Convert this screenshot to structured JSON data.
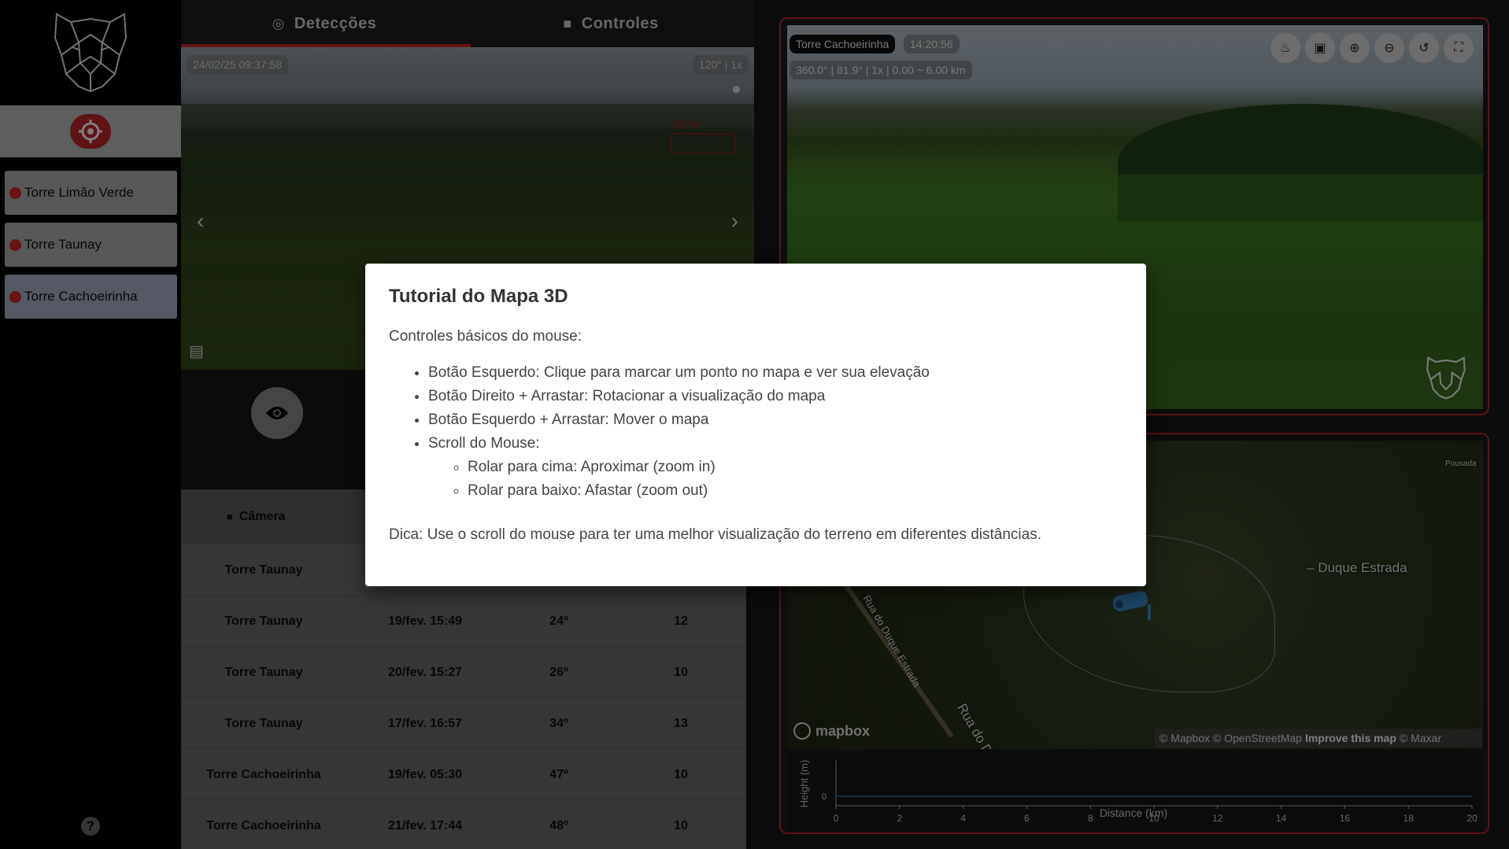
{
  "sidebar": {
    "towers": [
      {
        "label": "Torre Limão Verde"
      },
      {
        "label": "Torre Taunay"
      },
      {
        "label": "Torre Cachoeirinha"
      }
    ],
    "help": "?"
  },
  "tabs": {
    "detections": "Detecções",
    "controls": "Controles"
  },
  "camera": {
    "timestamp": "24/02/25 09:37:58",
    "fov_zoom": "120° | 1x",
    "detection_label": "82 %"
  },
  "table": {
    "headers": [
      "Câmera",
      "",
      "",
      ""
    ],
    "rows": [
      {
        "camera": "Torre Taunay",
        "date": "",
        "angle": "",
        "count": ""
      },
      {
        "camera": "Torre Taunay",
        "date": "19/fev. 15:49",
        "angle": "24º",
        "count": "12"
      },
      {
        "camera": "Torre Taunay",
        "date": "20/fev. 15:27",
        "angle": "26º",
        "count": "10"
      },
      {
        "camera": "Torre Taunay",
        "date": "17/fev. 16:57",
        "angle": "34º",
        "count": "13"
      },
      {
        "camera": "Torre Cachoeirinha",
        "date": "19/fev. 05:30",
        "angle": "47º",
        "count": "10"
      },
      {
        "camera": "Torre Cachoeirinha",
        "date": "21/fev. 17:44",
        "angle": "48º",
        "count": "10"
      }
    ]
  },
  "live": {
    "tower_name": "Torre Cachoeirinha",
    "time": "14:20:56",
    "info": "360.0° | 81.9° | 1x | 0.00 ~ 6.00 km"
  },
  "map": {
    "place_label": "Duque Estrada",
    "road_label_1": "Rua do Duque Estrada",
    "road_label_2": "Rua do D",
    "poi": "Pousada",
    "brand": "mapbox",
    "attribution_1": "© Mapbox © OpenStreetMap",
    "attribution_link": "Improve this map",
    "attribution_2": "© Maxar"
  },
  "profile_chart": {
    "ylabel": "Height (m)",
    "xlabel": "Distance (km)",
    "y_tick": "0",
    "x_ticks": [
      "0",
      "2",
      "4",
      "6",
      "8",
      "10",
      "12",
      "14",
      "16",
      "18",
      "20"
    ]
  },
  "chart_data": {
    "type": "line",
    "xlabel": "Distance (km)",
    "ylabel": "Height (m)",
    "xlim": [
      0,
      20
    ],
    "x": [
      0,
      20
    ],
    "series": [
      {
        "values": [
          0,
          0
        ]
      }
    ]
  },
  "modal": {
    "title": "Tutorial do Mapa 3D",
    "intro": "Controles básicos do mouse:",
    "items": [
      "Botão Esquerdo: Clique para marcar um ponto no mapa e ver sua elevação",
      "Botão Direito + Arrastar: Rotacionar a visualização do mapa",
      "Botão Esquerdo + Arrastar: Mover o mapa",
      "Scroll do Mouse:"
    ],
    "subitems": [
      "Rolar para cima: Aproximar (zoom in)",
      "Rolar para baixo: Afastar (zoom out)"
    ],
    "tip": "Dica: Use o scroll do mouse para ter uma melhor visualização do terreno em diferentes distâncias."
  },
  "colors": {
    "accent_red": "#c0262c",
    "line_blue": "#2a6db0"
  }
}
